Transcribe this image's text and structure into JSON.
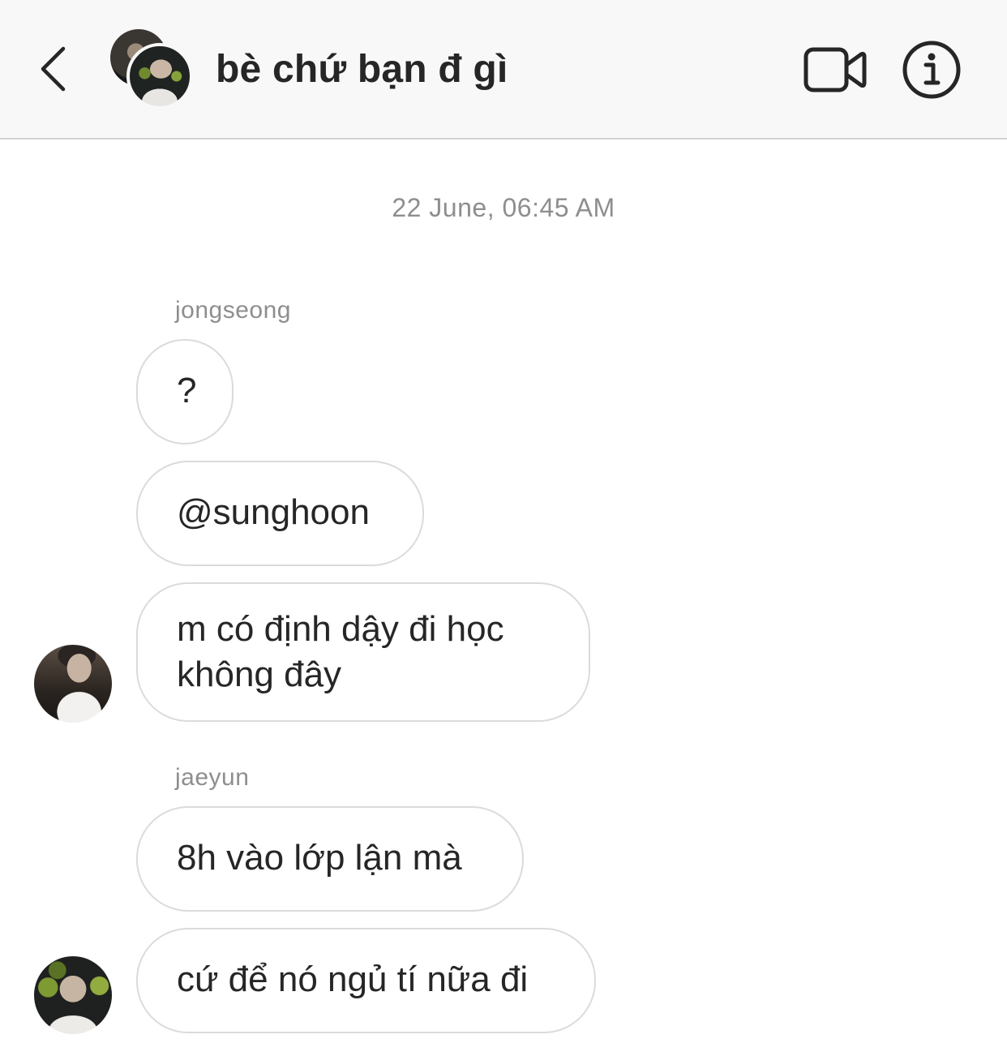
{
  "header": {
    "title": "bè chứ bạn đ gì",
    "back_icon": "chevron-left-icon",
    "video_icon": "video-camera-icon",
    "info_icon": "info-icon"
  },
  "conversation": {
    "timestamp": "22 June, 06:45 AM",
    "groups": [
      {
        "sender": "jongseong",
        "messages": [
          "?",
          "@sunghoon",
          "m có định dậy đi học không đây"
        ]
      },
      {
        "sender": "jaeyun",
        "messages": [
          "8h vào lớp lận mà",
          "cứ để nó ngủ tí nữa đi"
        ]
      }
    ]
  },
  "colors": {
    "header_bg": "#f8f8f8",
    "bubble_border": "#dbdbdb",
    "text": "#262626",
    "muted": "#8e8e8e"
  }
}
